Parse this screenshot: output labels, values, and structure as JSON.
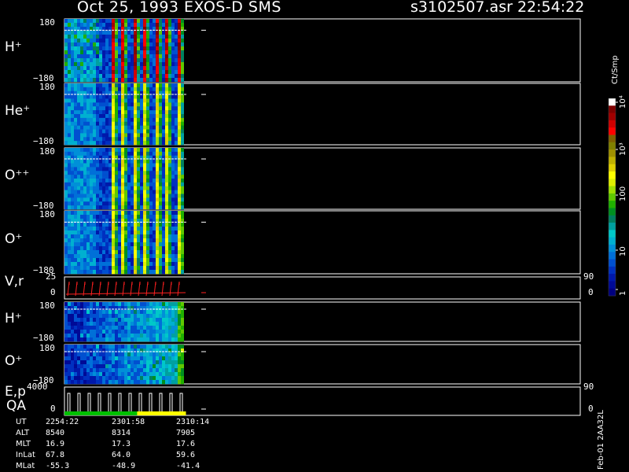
{
  "header": {
    "title": "Oct 25, 1993   EXOS-D SMS",
    "file_info": "s3102507.asr  22:54:22"
  },
  "colorbar": {
    "unit": "Ct/Smp",
    "tick_labels": [
      "1",
      "10",
      "100",
      "10³",
      "10⁴"
    ],
    "colors": [
      "#000080",
      "#000a96",
      "#0018aa",
      "#0030c0",
      "#0050d0",
      "#0070d8",
      "#0090d8",
      "#00b0d0",
      "#00c8c8",
      "#00a0a0",
      "#008060",
      "#009020",
      "#20b000",
      "#60c800",
      "#a0e000",
      "#e0f000",
      "#ffff00",
      "#e0d000",
      "#c0b000",
      "#a09000",
      "#808000",
      "#806000",
      "#ff0000",
      "#d00000",
      "#a00000",
      "#800000",
      "#ffffff"
    ]
  },
  "footer": {
    "id": "Feb-01 2AA32L"
  },
  "ephemeris": {
    "rows": [
      {
        "label": "UT",
        "values": [
          "2254:22",
          "2301:58",
          "2310:14"
        ]
      },
      {
        "label": "ALT",
        "values": [
          "8540",
          "8314",
          "7905"
        ]
      },
      {
        "label": "MLT",
        "values": [
          "16.9",
          "17.3",
          "17.6"
        ]
      },
      {
        "label": "InLat",
        "values": [
          "67.8",
          "64.0",
          "59.6"
        ]
      },
      {
        "label": "MLat",
        "values": [
          "-55.3",
          "-48.9",
          "-41.4"
        ]
      }
    ]
  },
  "chart_data": {
    "type": "heatmap",
    "x_axis": {
      "quantity": "UT",
      "start": "2254:22",
      "ticks": [
        "2254:22",
        "2301:58",
        "2310:14"
      ]
    },
    "panels": [
      {
        "label": "H⁺",
        "kind": "spectrogram",
        "ylim": [
          -180,
          180
        ],
        "tick_top": "180",
        "tick_bottom": "−180",
        "pattern": "stripes",
        "max_level": 25
      },
      {
        "label": "He⁺",
        "kind": "spectrogram",
        "ylim": [
          -180,
          180
        ],
        "tick_top": "180",
        "tick_bottom": "−180",
        "pattern": "stripes",
        "max_level": 17
      },
      {
        "label": "O⁺⁺",
        "kind": "spectrogram",
        "ylim": [
          -180,
          180
        ],
        "tick_top": "180",
        "tick_bottom": "−180",
        "pattern": "stripes",
        "max_level": 17
      },
      {
        "label": "O⁺",
        "kind": "spectrogram",
        "ylim": [
          -180,
          180
        ],
        "tick_top": "180",
        "tick_bottom": "−180",
        "pattern": "stripes",
        "max_level": 17
      },
      {
        "label": "V,r",
        "kind": "line",
        "ylim": [
          0,
          25
        ],
        "tick_top": "25",
        "tick_bottom": "0",
        "right_ticks": [
          "90",
          "0"
        ],
        "color": "#ff2020"
      },
      {
        "label": "H⁺",
        "kind": "spectrogram",
        "ylim": [
          -180,
          180
        ],
        "tick_top": "180",
        "tick_bottom": "−180",
        "pattern": "patchy",
        "max_level": 12
      },
      {
        "label": "O⁺",
        "kind": "spectrogram",
        "ylim": [
          -180,
          180
        ],
        "tick_top": "180",
        "tick_bottom": "−180",
        "pattern": "patchy",
        "max_level": 12
      },
      {
        "label": "E,p",
        "label2": "QA",
        "kind": "line",
        "ylim": [
          0,
          4000
        ],
        "tick_top": "4000",
        "tick_bottom": "0",
        "right_ticks": [
          "90",
          "0"
        ],
        "color": "#ffffff"
      }
    ],
    "qa_bar": [
      "#00c000",
      "#00c000",
      "#00c000",
      "#ffff00",
      "#ffff00"
    ]
  }
}
